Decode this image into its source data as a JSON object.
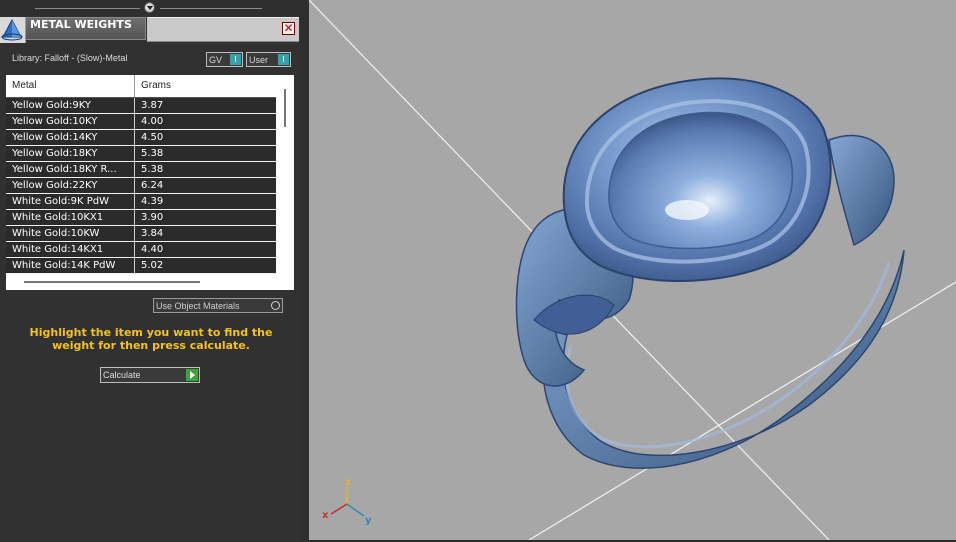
{
  "panel": {
    "title": "METAL WEIGHTS",
    "close_glyph": "✕",
    "library_label": "Library: Falloff - (Slow)-Metal",
    "gv_field": "GV",
    "user_field": "User",
    "field_button": "I",
    "table": {
      "headers": [
        "Metal",
        "Grams"
      ],
      "rows": [
        {
          "metal": "Yellow Gold:9KY",
          "grams": "3.87"
        },
        {
          "metal": "Yellow Gold:10KY",
          "grams": "4.00"
        },
        {
          "metal": "Yellow Gold:14KY",
          "grams": "4.50"
        },
        {
          "metal": "Yellow Gold:18KY",
          "grams": "5.38"
        },
        {
          "metal": "Yellow Gold:18KY R...",
          "grams": "5.38"
        },
        {
          "metal": "Yellow Gold:22KY",
          "grams": "6.24"
        },
        {
          "metal": "White Gold:9K PdW",
          "grams": "4.39"
        },
        {
          "metal": "White Gold:10KX1",
          "grams": "3.90"
        },
        {
          "metal": "White Gold:10KW",
          "grams": "3.84"
        },
        {
          "metal": "White Gold:14KX1",
          "grams": "4.40"
        },
        {
          "metal": "White Gold:14K PdW",
          "grams": "5.02"
        }
      ]
    },
    "use_object_materials": "Use Object Materials",
    "instruction": "Highlight the item you want to find the weight for then press calculate.",
    "calculate_label": "Calculate"
  },
  "viewport": {
    "axes": {
      "x": "x",
      "y": "y",
      "z": "z"
    },
    "background": "#a7a7a7",
    "model_color": "#6d8fc4"
  },
  "icons": {
    "panel": "pyramid-icon",
    "close": "close-icon",
    "calculate": "play-arrow-icon",
    "collapse": "chevron-down-icon"
  }
}
